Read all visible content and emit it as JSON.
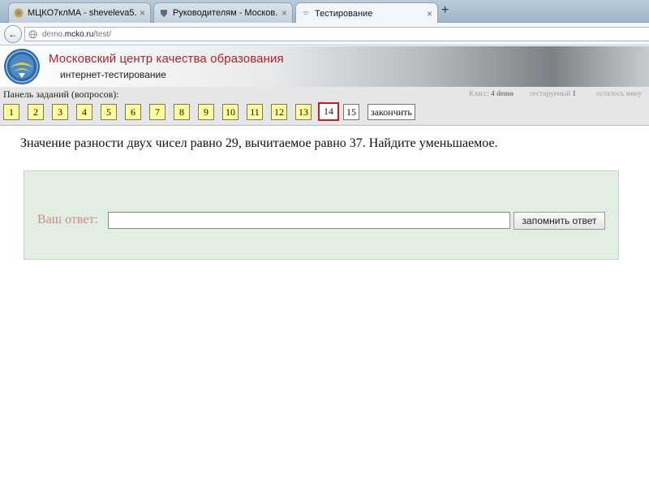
{
  "browser": {
    "tabs": [
      {
        "title": "МЦКО7клМА - sheveleva5...",
        "icon": "chrome-globe-icon",
        "active": false
      },
      {
        "title": "Руководителям - Москов...",
        "icon": "crest-icon",
        "active": false
      },
      {
        "title": "Тестирование",
        "icon": "mcko-logo-icon",
        "active": true
      }
    ],
    "close_glyph": "×",
    "new_tab_glyph": "+",
    "back_glyph": "←",
    "url": {
      "prefix": "demo.",
      "host": "mcko.ru",
      "path": "/test/"
    }
  },
  "header": {
    "title": "Московский центр качества образования",
    "subtitle": "интернет-тестирование"
  },
  "panel": {
    "label": "Панель заданий (вопросов):",
    "status": {
      "class_label": "Класс:",
      "class_value": "4 demo",
      "tested_label": "тестируемый",
      "tested_value": "1",
      "remaining": "осталось мину"
    },
    "questions": [
      "1",
      "2",
      "3",
      "4",
      "5",
      "6",
      "7",
      "8",
      "9",
      "10",
      "11",
      "12",
      "13",
      "14",
      "15"
    ],
    "current_question": "14",
    "finish_label": "закончить"
  },
  "question_text": "Значение разности двух чисел равно 29, вычитаемое равно 37. Найдите уменьшаемое.",
  "answer": {
    "label": "Ваш ответ:",
    "value": "",
    "submit_label": "запомнить ответ"
  }
}
